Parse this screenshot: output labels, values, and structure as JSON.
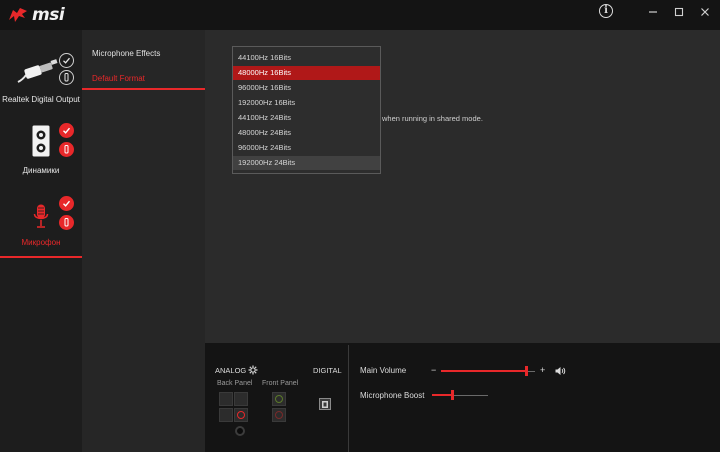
{
  "titlebar": {
    "logo_text": "msi",
    "info_icon": "info-icon",
    "minimize_icon": "minimize-icon",
    "maximize_icon": "maximize-icon",
    "close_icon": "close-icon"
  },
  "devices": [
    {
      "label": "Realtek Digital Output",
      "icon": "digital-output-cable-icon",
      "active": false
    },
    {
      "label": "Динамики",
      "icon": "speaker-icon",
      "active": false
    },
    {
      "label": "Микрофон",
      "icon": "microphone-icon",
      "active": true
    }
  ],
  "tabs": [
    {
      "label": "Microphone Effects",
      "active": false
    },
    {
      "label": "Default Format",
      "active": true
    }
  ],
  "hint_text": "when running in shared mode.",
  "format_dropdown": {
    "options": [
      "44100Hz 16Bits",
      "48000Hz 16Bits",
      "96000Hz 16Bits",
      "192000Hz 16Bits",
      "44100Hz 24Bits",
      "48000Hz 24Bits",
      "96000Hz 24Bits",
      "192000Hz 24Bits"
    ],
    "selected": "48000Hz 16Bits",
    "hovered": "192000Hz 24Bits"
  },
  "connectors": {
    "analog_label": "ANALOG",
    "digital_label": "DIGITAL",
    "back_panel_label": "Back Panel",
    "front_panel_label": "Front Panel"
  },
  "controls": {
    "main_volume_label": "Main Volume",
    "main_volume_minus": "−",
    "main_volume_plus": "+",
    "main_volume_level": 0.9,
    "microphone_boost_label": "Microphone Boost",
    "microphone_boost_level": 0.35
  },
  "colors": {
    "accent": "#e8282a",
    "selected_option": "#b01818"
  }
}
